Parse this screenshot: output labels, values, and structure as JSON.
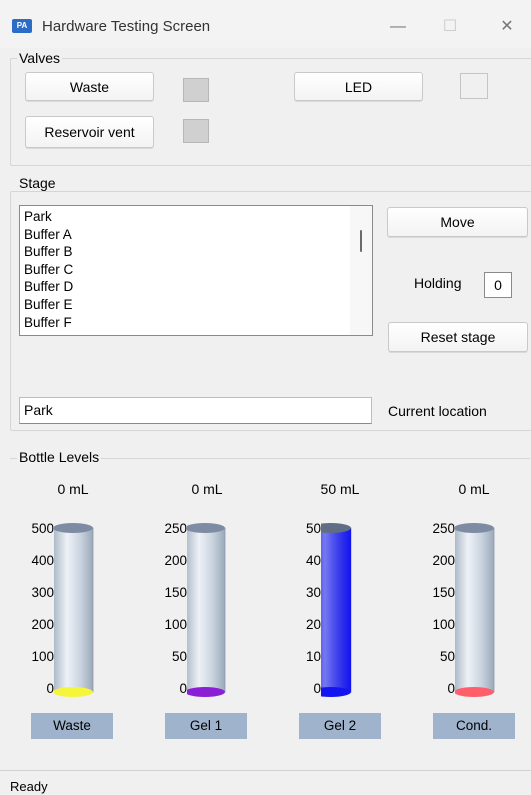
{
  "window": {
    "title": "Hardware Testing Screen",
    "icon_text": "PA",
    "minimize": "—",
    "maximize": "☐",
    "close": "✕"
  },
  "valves": {
    "group_title": "Valves",
    "waste_label": "Waste",
    "led_label": "LED",
    "reservoir_label": "Reservoir vent"
  },
  "stage": {
    "group_title": "Stage",
    "items": [
      "Park",
      "Buffer A",
      "Buffer B",
      "Buffer C",
      "Buffer D",
      "Buffer E",
      "Buffer F"
    ],
    "move_label": "Move",
    "holding_label": "Holding",
    "holding_value": "0",
    "reset_label": "Reset stage",
    "current_location_value": "Park",
    "current_location_label": "Current location"
  },
  "bottles": {
    "group_title": "Bottle Levels",
    "items": [
      {
        "name": "Waste",
        "amount": "0 mL",
        "ticks": [
          "500",
          "400",
          "300",
          "200",
          "100",
          "0"
        ],
        "fill": 0,
        "color": "#f5f53a"
      },
      {
        "name": "Gel 1",
        "amount": "0 mL",
        "ticks": [
          "250",
          "200",
          "150",
          "100",
          "50",
          "0"
        ],
        "fill": 0,
        "color": "#8a1fd6"
      },
      {
        "name": "Gel 2",
        "amount": "50 mL",
        "ticks": [
          "50",
          "40",
          "30",
          "20",
          "10",
          "0"
        ],
        "fill": 1,
        "color": "#1414f0"
      },
      {
        "name": "Cond.",
        "amount": "0 mL",
        "ticks": [
          "250",
          "200",
          "150",
          "100",
          "50",
          "0"
        ],
        "fill": 0,
        "color": "#ff5f6a"
      }
    ]
  },
  "status": {
    "text": "Ready"
  }
}
